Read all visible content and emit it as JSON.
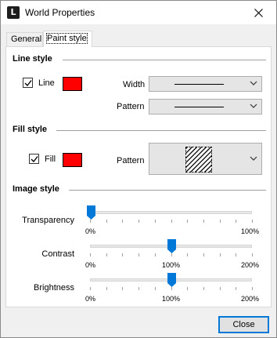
{
  "window": {
    "title": "World Properties",
    "app_icon_letter": "L"
  },
  "tabs": [
    {
      "label": "General",
      "active": false
    },
    {
      "label": "Paint style",
      "active": true
    }
  ],
  "line_style": {
    "heading": "Line style",
    "checkbox_label": "Line",
    "checked": true,
    "color": "#ff0000",
    "width_label": "Width",
    "pattern_label": "Pattern"
  },
  "fill_style": {
    "heading": "Fill style",
    "checkbox_label": "Fill",
    "checked": true,
    "color": "#ff0000",
    "pattern_label": "Pattern",
    "pattern_value": "diagonal-hatch"
  },
  "image_style": {
    "heading": "Image style",
    "transparency": {
      "label": "Transparency",
      "value_percent": 0,
      "min_label": "0%",
      "max_label": "100%"
    },
    "contrast": {
      "label": "Contrast",
      "value_percent": 100,
      "min_label": "0%",
      "mid_label": "100%",
      "max_label": "200%"
    },
    "brightness": {
      "label": "Brightness",
      "value_percent": 100,
      "min_label": "0%",
      "mid_label": "100%",
      "max_label": "200%"
    }
  },
  "buttons": {
    "close": "Close"
  },
  "icons": {
    "window_close": "close-icon",
    "dropdown": "chevron-down-icon",
    "app": "app-icon"
  },
  "colors": {
    "accent": "#0078d7",
    "slider_thumb": "#0078d7",
    "swatch": "#ff0000"
  }
}
